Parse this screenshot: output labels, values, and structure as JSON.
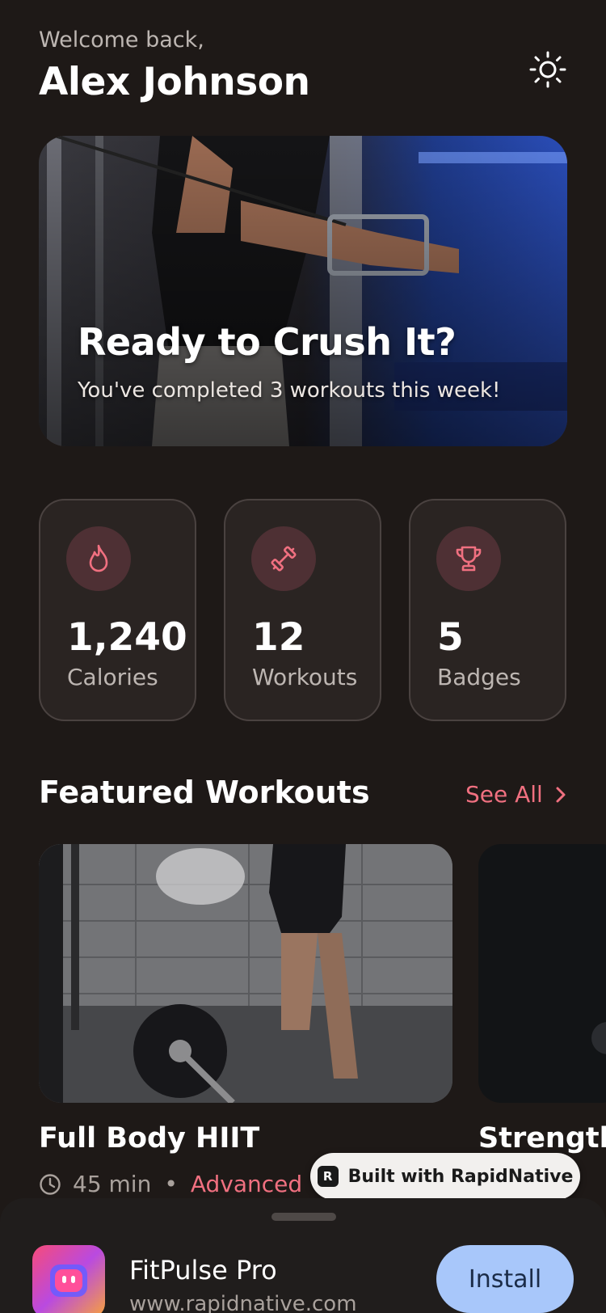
{
  "header": {
    "greeting": "Welcome back,",
    "user_name": "Alex Johnson",
    "theme_icon": "sun-icon"
  },
  "hero": {
    "title": "Ready to Crush It?",
    "subtitle": "You've completed 3 workouts this week!"
  },
  "stats": [
    {
      "icon": "flame-icon",
      "value": "1,240",
      "label": "Calories"
    },
    {
      "icon": "dumbbell-icon",
      "value": "12",
      "label": "Workouts"
    },
    {
      "icon": "trophy-icon",
      "value": "5",
      "label": "Badges"
    }
  ],
  "featured": {
    "title": "Featured Workouts",
    "see_all": "See All",
    "workouts": [
      {
        "title": "Full Body HIIT",
        "duration": "45 min",
        "level": "Advanced"
      },
      {
        "title": "Strength"
      }
    ]
  },
  "badge": {
    "label": "Built with RapidNative",
    "logo_letter": "R"
  },
  "install_sheet": {
    "app_name": "FitPulse Pro",
    "app_url": "www.rapidnative.com",
    "install_label": "Install"
  },
  "colors": {
    "background": "#1e1917",
    "accent": "#f07080",
    "card": "#2a2422",
    "install_button": "#a8c7fa"
  }
}
